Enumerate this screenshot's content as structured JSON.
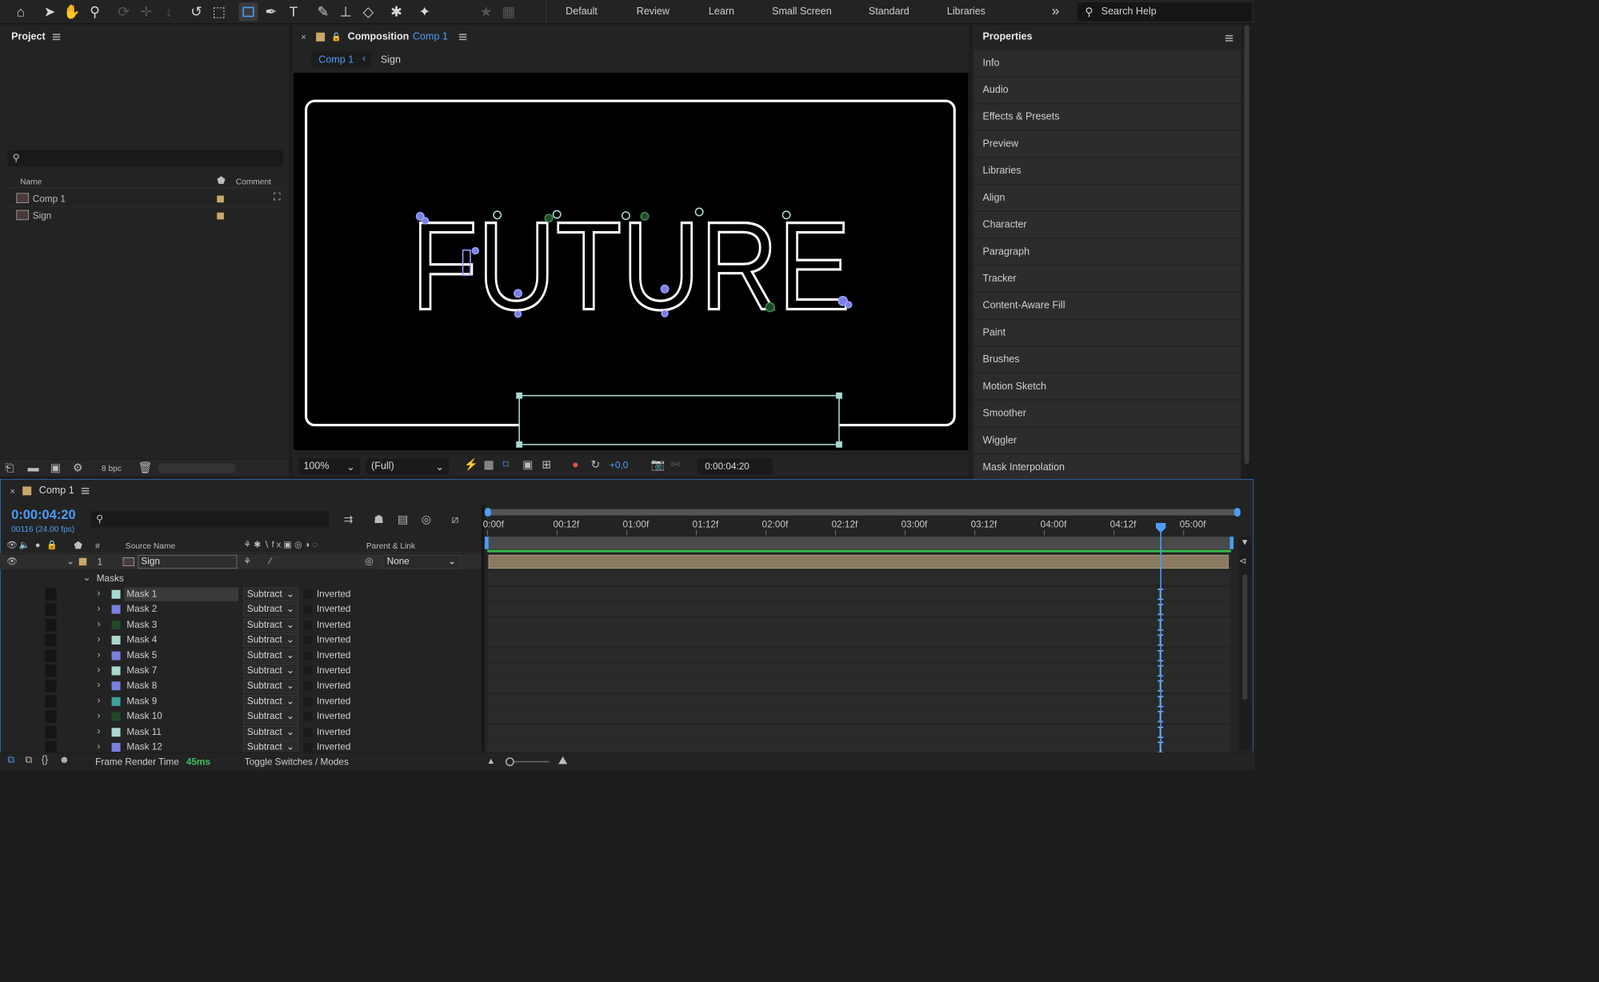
{
  "toolbar": {
    "workspaces": [
      "Default",
      "Review",
      "Learn",
      "Small Screen",
      "Standard",
      "Libraries"
    ],
    "overflow": "»",
    "search_placeholder": "Search Help"
  },
  "project": {
    "title": "Project",
    "columns": {
      "name": "Name",
      "comment": "Comment"
    },
    "items": [
      {
        "name": "Comp 1",
        "icon": "composition-icon"
      },
      {
        "name": "Sign",
        "icon": "composition-icon"
      }
    ],
    "bpc": "8 bpc"
  },
  "composition": {
    "title": "Composition",
    "comp_name": "Comp 1",
    "breadcrumb": [
      "Comp 1",
      "Sign"
    ],
    "viewer_text": "FUTURE",
    "zoom": "100%",
    "resolution": "(Full)",
    "exposure": "+0,0",
    "timecode": "0:00:04:20"
  },
  "properties": {
    "title": "Properties",
    "items": [
      "Info",
      "Audio",
      "Effects & Presets",
      "Preview",
      "Libraries",
      "Align",
      "Character",
      "Paragraph",
      "Tracker",
      "Content-Aware Fill",
      "Paint",
      "Brushes",
      "Motion Sketch",
      "Smoother",
      "Wiggler",
      "Mask Interpolation"
    ]
  },
  "timeline": {
    "tab": "Comp 1",
    "timecode": "0:00:04:20",
    "frame_info": "00116 (24.00 fps)",
    "headers": {
      "num": "#",
      "source_name": "Source Name",
      "parent": "Parent & Link"
    },
    "layer": {
      "index": "1",
      "name": "Sign",
      "parent": "None"
    },
    "masks_label": "Masks",
    "masks": [
      {
        "name": "Mask 1",
        "mode": "Subtract",
        "inverted": "Inverted",
        "color": "#a8d8cf"
      },
      {
        "name": "Mask 2",
        "mode": "Subtract",
        "inverted": "Inverted",
        "color": "#7a7fe0"
      },
      {
        "name": "Mask 3",
        "mode": "Subtract",
        "inverted": "Inverted",
        "color": "#1f4a2a"
      },
      {
        "name": "Mask 4",
        "mode": "Subtract",
        "inverted": "Inverted",
        "color": "#a8d8cf"
      },
      {
        "name": "Mask 5",
        "mode": "Subtract",
        "inverted": "Inverted",
        "color": "#7a7fe0"
      },
      {
        "name": "Mask 7",
        "mode": "Subtract",
        "inverted": "Inverted",
        "color": "#a8d8cf"
      },
      {
        "name": "Mask 8",
        "mode": "Subtract",
        "inverted": "Inverted",
        "color": "#7a7fe0"
      },
      {
        "name": "Mask 9",
        "mode": "Subtract",
        "inverted": "Inverted",
        "color": "#3aa39a"
      },
      {
        "name": "Mask 10",
        "mode": "Subtract",
        "inverted": "Inverted",
        "color": "#1f4a2a"
      },
      {
        "name": "Mask 11",
        "mode": "Subtract",
        "inverted": "Inverted",
        "color": "#a8d8cf"
      },
      {
        "name": "Mask 12",
        "mode": "Subtract",
        "inverted": "Inverted",
        "color": "#7a7fe0"
      }
    ],
    "ruler": [
      "0:00f",
      "00:12f",
      "01:00f",
      "01:12f",
      "02:00f",
      "02:12f",
      "03:00f",
      "03:12f",
      "04:00f",
      "04:12f",
      "05:00f"
    ],
    "footer": {
      "render_label": "Frame Render Time",
      "render_value": "45ms",
      "toggle": "Toggle Switches / Modes"
    }
  },
  "colors": {
    "accent": "#4a9df8",
    "layer_bar": "#8a7a62",
    "label_tan": "#c9a86a"
  }
}
